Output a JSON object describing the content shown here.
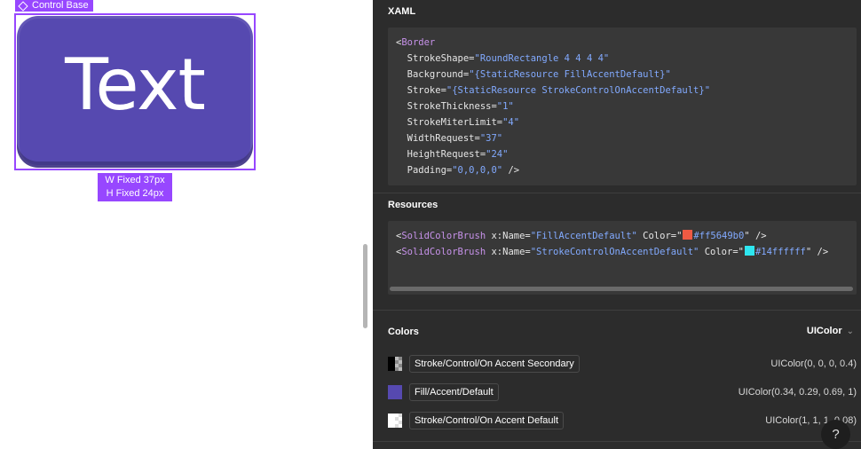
{
  "canvas": {
    "component_tag": "Control Base",
    "button_text": "Text",
    "size_width": "W  Fixed  37px",
    "size_height": "H  Fixed  24px"
  },
  "xaml": {
    "title": "XAML",
    "tag_open": "<",
    "tag_name": "Border",
    "attributes": [
      {
        "name": "StrokeShape",
        "value": "RoundRectangle 4 4 4 4"
      },
      {
        "name": "Background",
        "value": "{StaticResource FillAccentDefault}"
      },
      {
        "name": "Stroke",
        "value": "{StaticResource StrokeControlOnAccentDefault}"
      },
      {
        "name": "StrokeThickness",
        "value": "1"
      },
      {
        "name": "StrokeMiterLimit",
        "value": "4"
      },
      {
        "name": "WidthRequest",
        "value": "37"
      },
      {
        "name": "HeightRequest",
        "value": "24"
      },
      {
        "name": "Padding",
        "value": "0,0,0,0"
      }
    ],
    "tag_close": " />"
  },
  "resources": {
    "title": "Resources",
    "items": [
      {
        "tag": "SolidColorBrush",
        "name_attr": "x:Name",
        "name": "FillAccentDefault",
        "color_attr": "Color",
        "color": "#ff5649b0",
        "swatch": "#ef5a43"
      },
      {
        "tag": "SolidColorBrush",
        "name_attr": "x:Name",
        "name": "StrokeControlOnAccentDefault",
        "color_attr": "Color",
        "color": "#14ffffff",
        "swatch": "#2ee6f0"
      }
    ]
  },
  "colors": {
    "title": "Colors",
    "format_selector": "UIColor",
    "items": [
      {
        "name": "Stroke/Control/On Accent Secondary",
        "value": "UIColor(0, 0, 0, 0.4)",
        "swatch_kind": "split-dark"
      },
      {
        "name": "Fill/Accent/Default",
        "value": "UIColor(0.34, 0.29, 0.69, 1)",
        "swatch_color": "#5649b0"
      },
      {
        "name": "Stroke/Control/On Accent Default",
        "value": "UIColor(1, 1, 1, 0.08)",
        "swatch_kind": "split-light"
      }
    ]
  },
  "help_label": "?"
}
